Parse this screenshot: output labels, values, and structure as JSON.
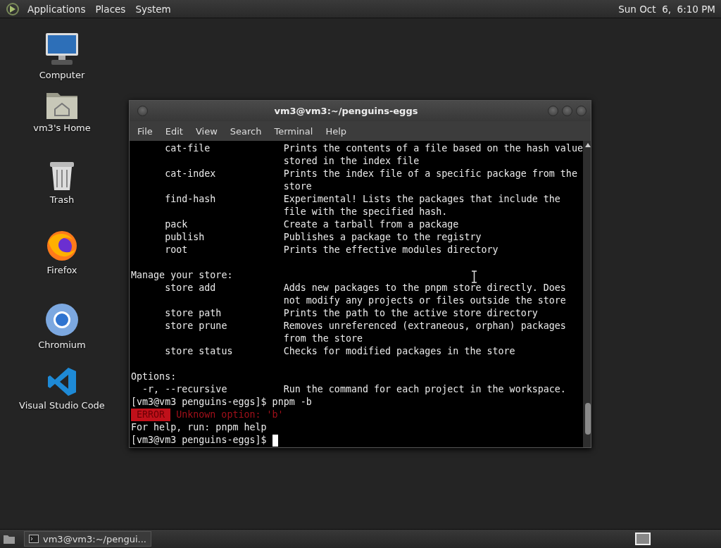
{
  "top_panel": {
    "menus": [
      "Applications",
      "Places",
      "System"
    ],
    "clock": "Sun Oct  6,  6:10 PM"
  },
  "desktop_icons": [
    {
      "kind": "computer",
      "label": "Computer"
    },
    {
      "kind": "home",
      "label": "vm3's Home"
    },
    {
      "kind": "trash",
      "label": "Trash"
    },
    {
      "kind": "firefox",
      "label": "Firefox"
    },
    {
      "kind": "chromium",
      "label": "Chromium"
    },
    {
      "kind": "vscode",
      "label": "Visual Studio Code"
    }
  ],
  "terminal": {
    "title": "vm3@vm3:~/penguins-eggs",
    "menu": [
      "File",
      "Edit",
      "View",
      "Search",
      "Terminal",
      "Help"
    ],
    "lines": [
      {
        "kind": "entry",
        "command": "cat-file",
        "description": "Prints the contents of a file based on the hash value"
      },
      {
        "kind": "entry",
        "description": "stored in the index file"
      },
      {
        "kind": "entry",
        "command": "cat-index",
        "description": "Prints the index file of a specific package from the"
      },
      {
        "kind": "entry",
        "description": "store"
      },
      {
        "kind": "entry",
        "command": "find-hash",
        "description": "Experimental! Lists the packages that include the"
      },
      {
        "kind": "entry",
        "description": "file with the specified hash."
      },
      {
        "kind": "entry",
        "command": "pack",
        "description": "Create a tarball from a package"
      },
      {
        "kind": "entry",
        "command": "publish",
        "description": "Publishes a package to the registry"
      },
      {
        "kind": "entry",
        "command": "root",
        "description": "Prints the effective modules directory"
      },
      {
        "kind": "blank"
      },
      {
        "kind": "text",
        "text": "Manage your store:"
      },
      {
        "kind": "entry",
        "command": "store add",
        "description": "Adds new packages to the pnpm store directly. Does"
      },
      {
        "kind": "entry",
        "description": "not modify any projects or files outside the store"
      },
      {
        "kind": "entry",
        "command": "store path",
        "description": "Prints the path to the active store directory"
      },
      {
        "kind": "entry",
        "command": "store prune",
        "description": "Removes unreferenced (extraneous, orphan) packages"
      },
      {
        "kind": "entry",
        "description": "from the store"
      },
      {
        "kind": "entry",
        "command": "store status",
        "description": "Checks for modified packages in the store"
      },
      {
        "kind": "blank"
      },
      {
        "kind": "text",
        "text": "Options:"
      },
      {
        "kind": "option",
        "command": "-r, --recursive",
        "description": "Run the command for each project in the workspace."
      },
      {
        "kind": "text",
        "text": "[vm3@vm3 penguins-eggs]$ pnpm -b"
      },
      {
        "kind": "error",
        "badge": "ERROR",
        "text": "Unknown option: 'b'"
      },
      {
        "kind": "text",
        "text": "For help, run: pnpm help"
      },
      {
        "kind": "input",
        "text": "[vm3@vm3 penguins-eggs]$"
      }
    ]
  },
  "taskbar": {
    "tasks": [
      {
        "label": "vm3@vm3:~/pengui...",
        "selected": false
      }
    ]
  }
}
